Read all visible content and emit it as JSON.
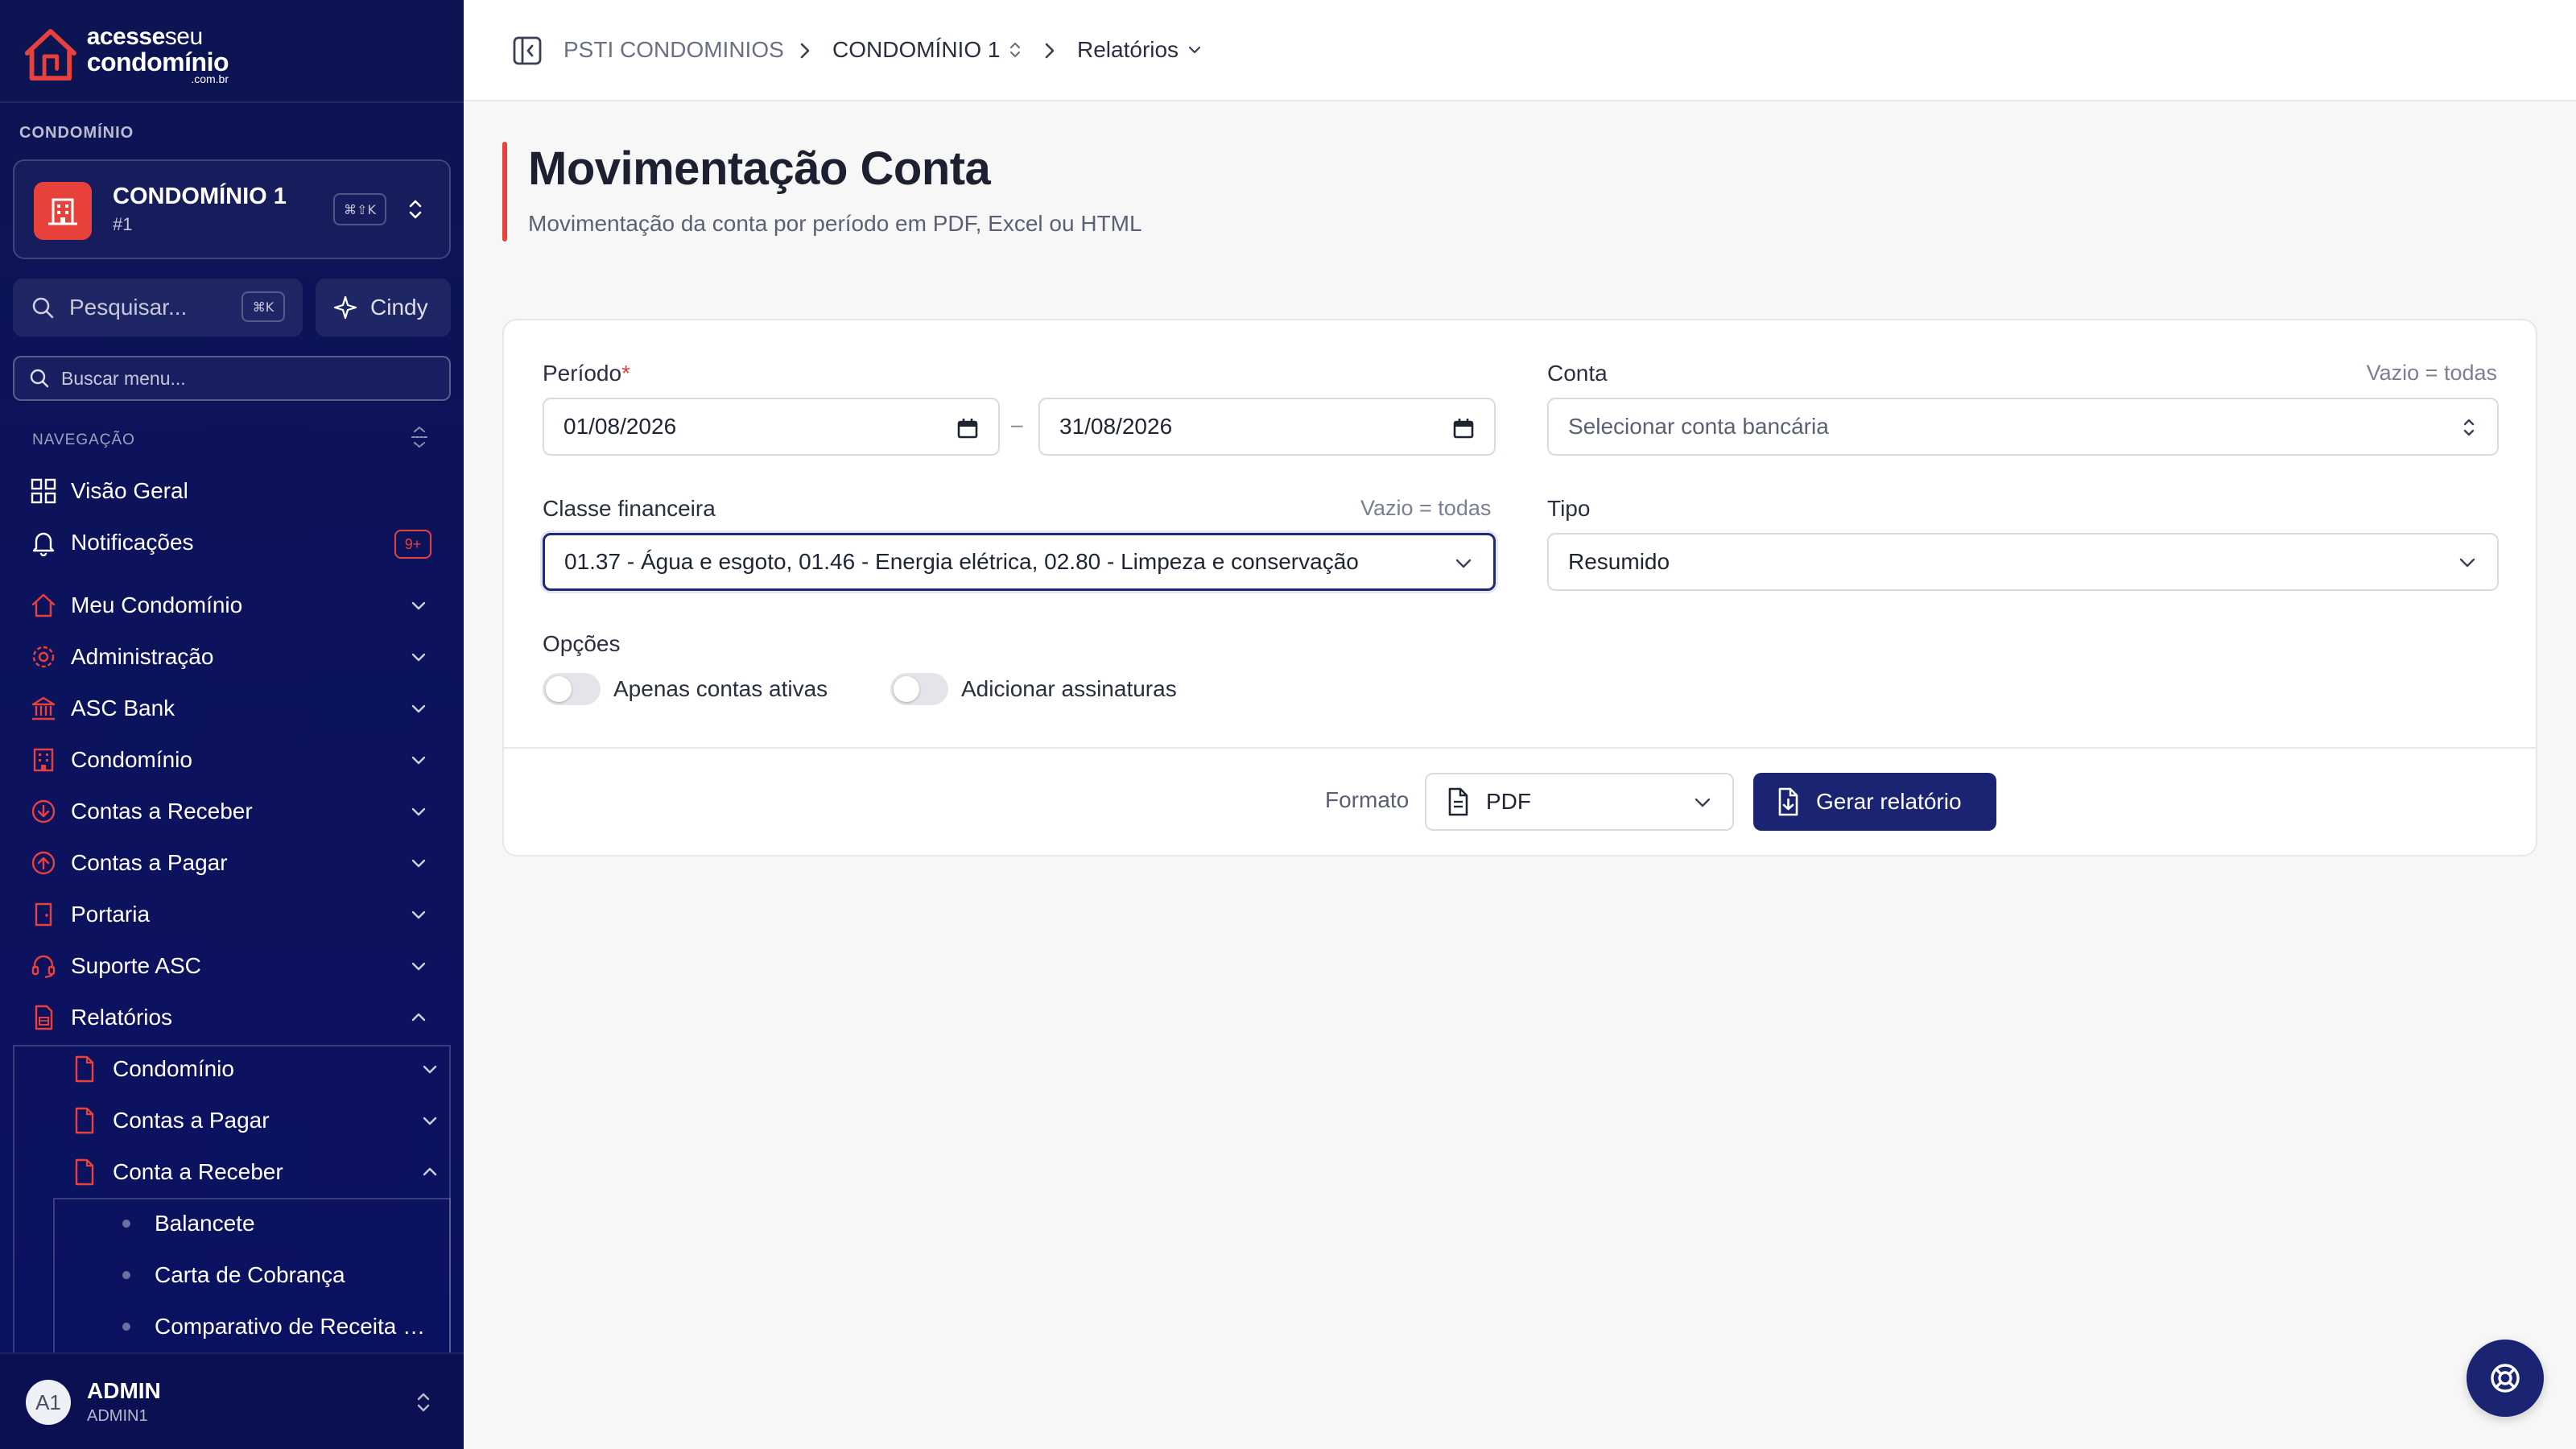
{
  "brand": {
    "line1a": "acesse",
    "line1b": "seu",
    "line2": "condomínio",
    "line3": ".com.br",
    "accent": "#e8413b",
    "navy": "#1b2373"
  },
  "sidebar": {
    "condo_section_label": "CONDOMÍNIO",
    "condo_name": "CONDOMÍNIO 1",
    "condo_number": "#1",
    "condo_shortcut": "⌘⇧K",
    "search_placeholder": "Pesquisar...",
    "search_shortcut": "⌘K",
    "assistant_label": "Cindy",
    "menu_search_placeholder": "Buscar menu...",
    "nav_section_label": "NAVEGAÇÃO",
    "items": [
      {
        "label": "Visão Geral",
        "icon": "grid-icon"
      },
      {
        "label": "Notificações",
        "icon": "bell-icon",
        "badge": "9+"
      },
      {
        "label": "Meu Condomínio",
        "icon": "home-icon"
      },
      {
        "label": "Administração",
        "icon": "gear-icon"
      },
      {
        "label": "ASC Bank",
        "icon": "bank-icon"
      },
      {
        "label": "Condomínio",
        "icon": "building-icon"
      },
      {
        "label": "Contas a Receber",
        "icon": "arrow-down-circle-icon"
      },
      {
        "label": "Contas a Pagar",
        "icon": "arrow-up-circle-icon"
      },
      {
        "label": "Portaria",
        "icon": "door-icon"
      },
      {
        "label": "Suporte ASC",
        "icon": "headset-icon"
      },
      {
        "label": "Relatórios",
        "icon": "report-icon"
      }
    ],
    "report_sub": [
      {
        "label": "Condomínio"
      },
      {
        "label": "Contas a Pagar"
      },
      {
        "label": "Conta a Receber"
      }
    ],
    "report_sub2": [
      {
        "label": "Balancete"
      },
      {
        "label": "Carta de Cobrança"
      },
      {
        "label": "Comparativo de Receita x Despesa"
      }
    ],
    "user": {
      "initials": "A1",
      "name": "ADMIN",
      "login": "ADMIN1"
    }
  },
  "breadcrumb": {
    "root": "PSTI CONDOMINIOS",
    "condo": "CONDOMÍNIO 1",
    "section": "Relatórios"
  },
  "page": {
    "title": "Movimentação Conta",
    "subtitle": "Movimentação da conta por período em PDF, Excel ou HTML"
  },
  "form": {
    "periodo_label": "Período",
    "required_mark": "*",
    "date_from": "01/08/2026",
    "date_to": "31/08/2026",
    "date_separator": "–",
    "conta_label": "Conta",
    "conta_hint": "Vazio = todas",
    "conta_placeholder": "Selecionar conta bancária",
    "classe_label": "Classe financeira",
    "classe_hint": "Vazio = todas",
    "classe_value": "01.37 - Água e esgoto, 01.46 - Energia elétrica, 02.80 - Limpeza e conservação",
    "tipo_label": "Tipo",
    "tipo_value": "Resumido",
    "opcoes_label": "Opções",
    "toggle1_label": "Apenas contas ativas",
    "toggle1_on": false,
    "toggle2_label": "Adicionar assinaturas",
    "toggle2_on": false,
    "formato_label": "Formato",
    "formato_value": "PDF",
    "submit_label": "Gerar relatório"
  }
}
